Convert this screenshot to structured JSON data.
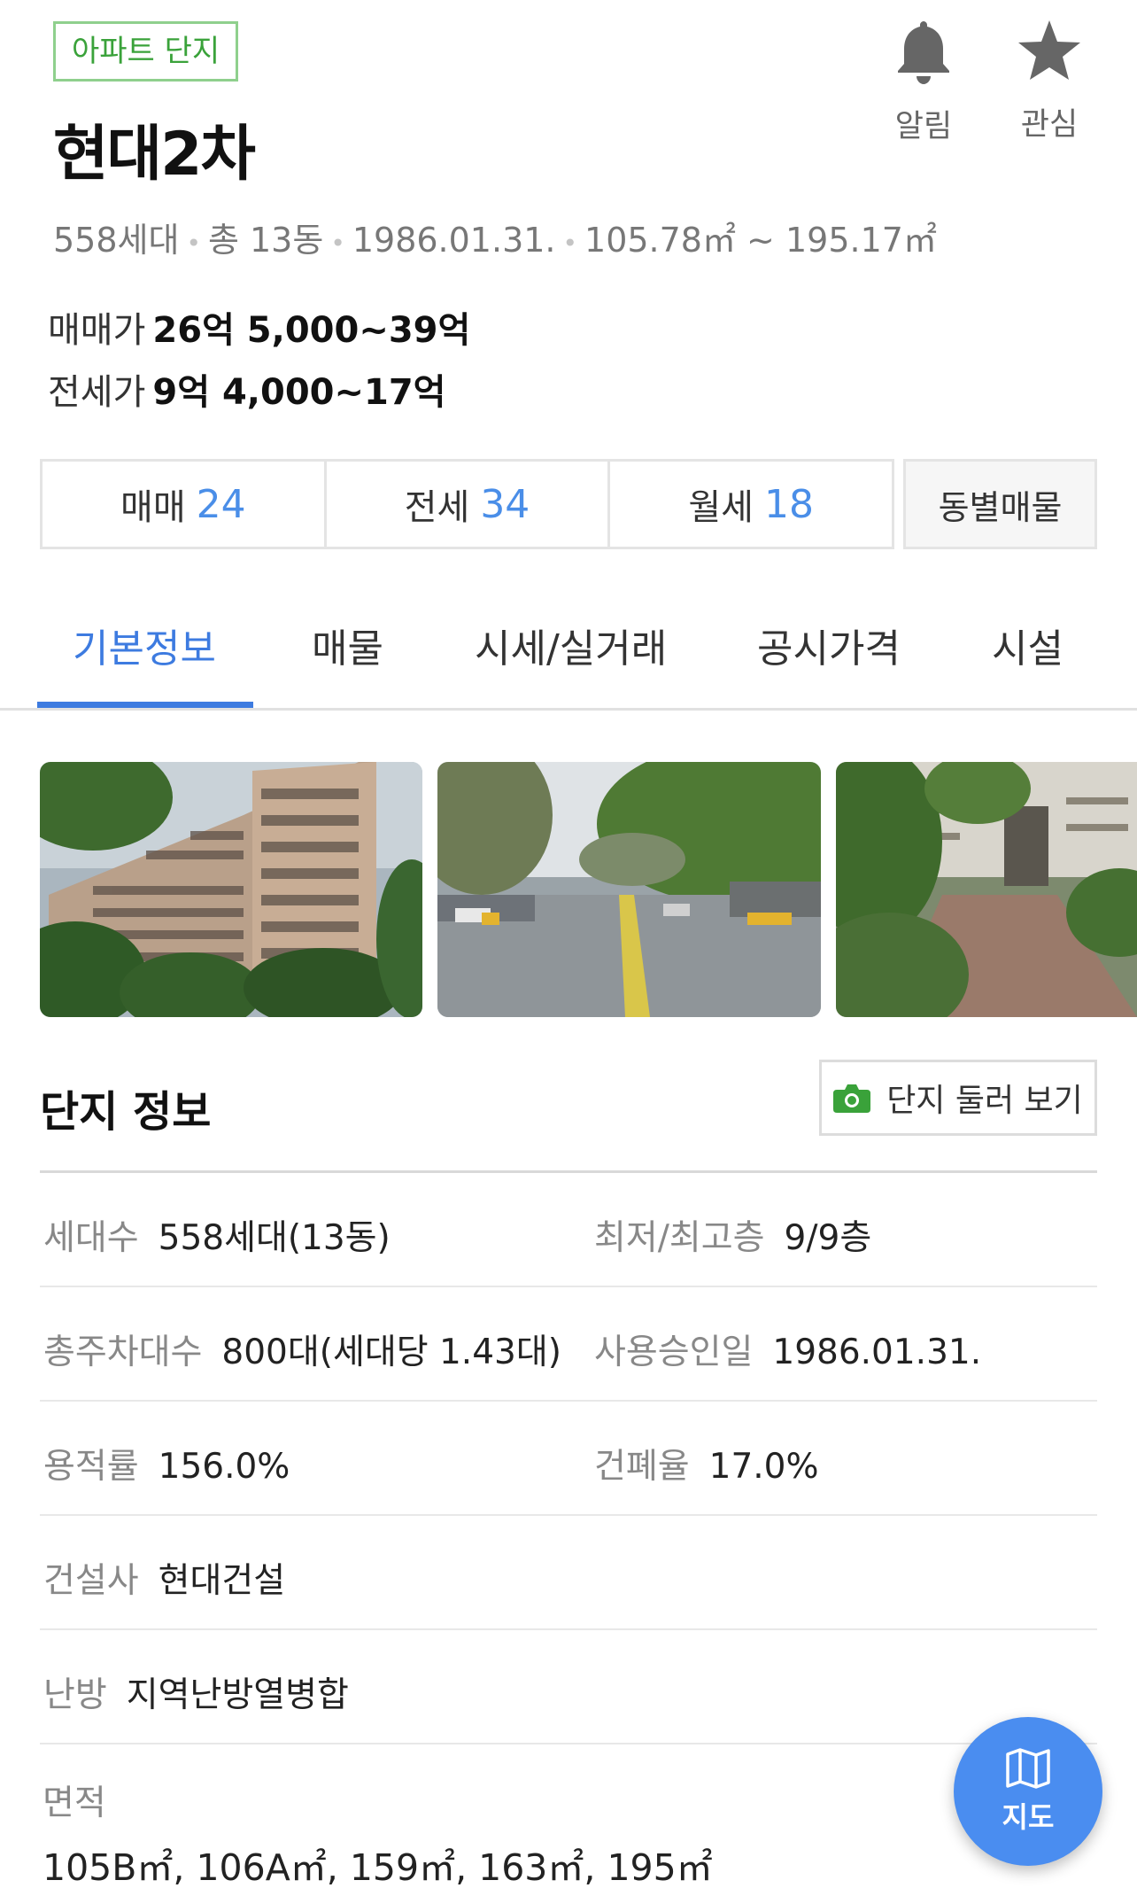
{
  "header": {
    "type_badge": "아파트 단지",
    "title": "현대2차",
    "alarm_label": "알림",
    "favorite_label": "관심"
  },
  "summary": {
    "households": "558세대",
    "buildings": "총 13동",
    "approval_date": "1986.01.31.",
    "area_range": "105.78㎡ ~ 195.17㎡"
  },
  "prices": {
    "sale_label": "매매가",
    "sale_value": "26억 5,000~39억",
    "lease_label": "전세가",
    "lease_value": "9억 4,000~17억"
  },
  "deal_tabs": [
    {
      "label": "매매",
      "count": "24"
    },
    {
      "label": "전세",
      "count": "34"
    },
    {
      "label": "월세",
      "count": "18"
    }
  ],
  "region_button": "동별매물",
  "nav_tabs": [
    "기본정보",
    "매물",
    "시세/실거래",
    "공시가격",
    "시설"
  ],
  "active_nav_tab": "기본정보",
  "complex": {
    "section_title": "단지 정보",
    "tour_button": "단지 둘러 보기",
    "rows": [
      [
        {
          "k": "세대수",
          "v": "558세대(13동)"
        },
        {
          "k": "최저/최고층",
          "v": "9/9층"
        }
      ],
      [
        {
          "k": "총주차대수",
          "v": "800대(세대당 1.43대)"
        },
        {
          "k": "사용승인일",
          "v": "1986.01.31."
        }
      ],
      [
        {
          "k": "용적률",
          "v": "156.0%"
        },
        {
          "k": "건폐율",
          "v": "17.0%"
        }
      ],
      [
        {
          "k": "건설사",
          "v": "현대건설"
        }
      ],
      [
        {
          "k": "난방",
          "v": "지역난방열병합"
        }
      ]
    ],
    "area_label": "면적",
    "area_value": "105B㎡, 106A㎡, 159㎡, 163㎡, 195㎡"
  },
  "map_button": "지도",
  "colors": {
    "accent": "#3d7be0",
    "badge_green": "#3aa23a",
    "fab_blue": "#4a8df0"
  },
  "icons": [
    "bell-icon",
    "star-icon",
    "camera-icon",
    "map-icon"
  ]
}
